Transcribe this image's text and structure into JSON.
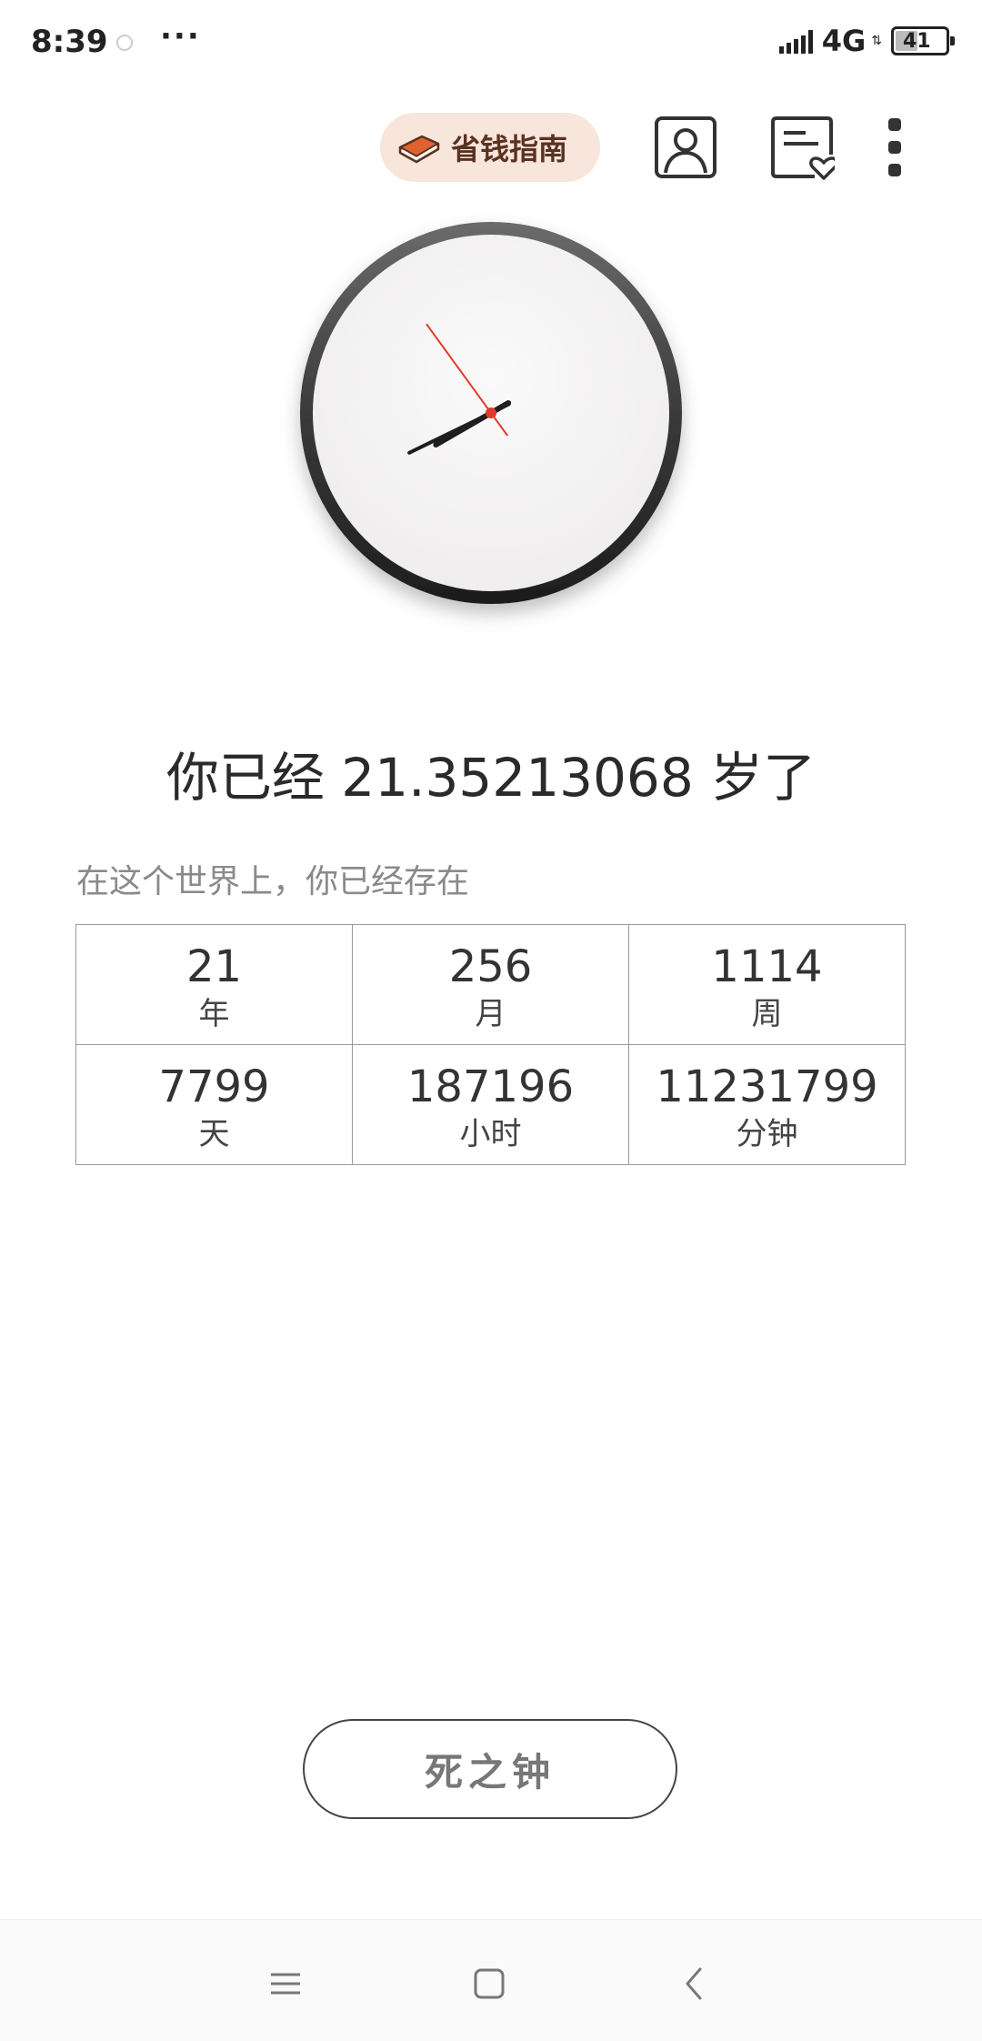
{
  "status_bar": {
    "time": "8:39",
    "dots": "···",
    "network": "4G",
    "battery": "41",
    "battery_level": 0.41
  },
  "header": {
    "guide_label": "省钱指南"
  },
  "clock": {
    "hour_hand_angle_deg": 240,
    "minute_hand_angle_deg": 244,
    "second_hand_angle_deg": 324
  },
  "age": {
    "text": "你已经 21.35213068 岁了"
  },
  "existence": {
    "caption": "在这个世界上，你已经存在",
    "stats": [
      {
        "value": "21",
        "unit": "年"
      },
      {
        "value": "256",
        "unit": "月"
      },
      {
        "value": "1114",
        "unit": "周"
      },
      {
        "value": "7799",
        "unit": "天"
      },
      {
        "value": "187196",
        "unit": "小时"
      },
      {
        "value": "11231799",
        "unit": "分钟"
      }
    ]
  },
  "death_clock_button": "死之钟",
  "colors": {
    "chip_bg": "#f8e5dc",
    "chip_text": "#5a3222",
    "book_orange": "#e0622f",
    "second_hand": "#e23a2a",
    "clock_ring": "#2b2b2b"
  },
  "icons": {
    "profile": "person-icon",
    "favlist": "list-heart-icon",
    "more": "vertical-dots-icon",
    "guide": "book-icon",
    "nav_menu": "menu-icon",
    "nav_home": "square-home-icon",
    "nav_back": "back-chevron-icon"
  }
}
